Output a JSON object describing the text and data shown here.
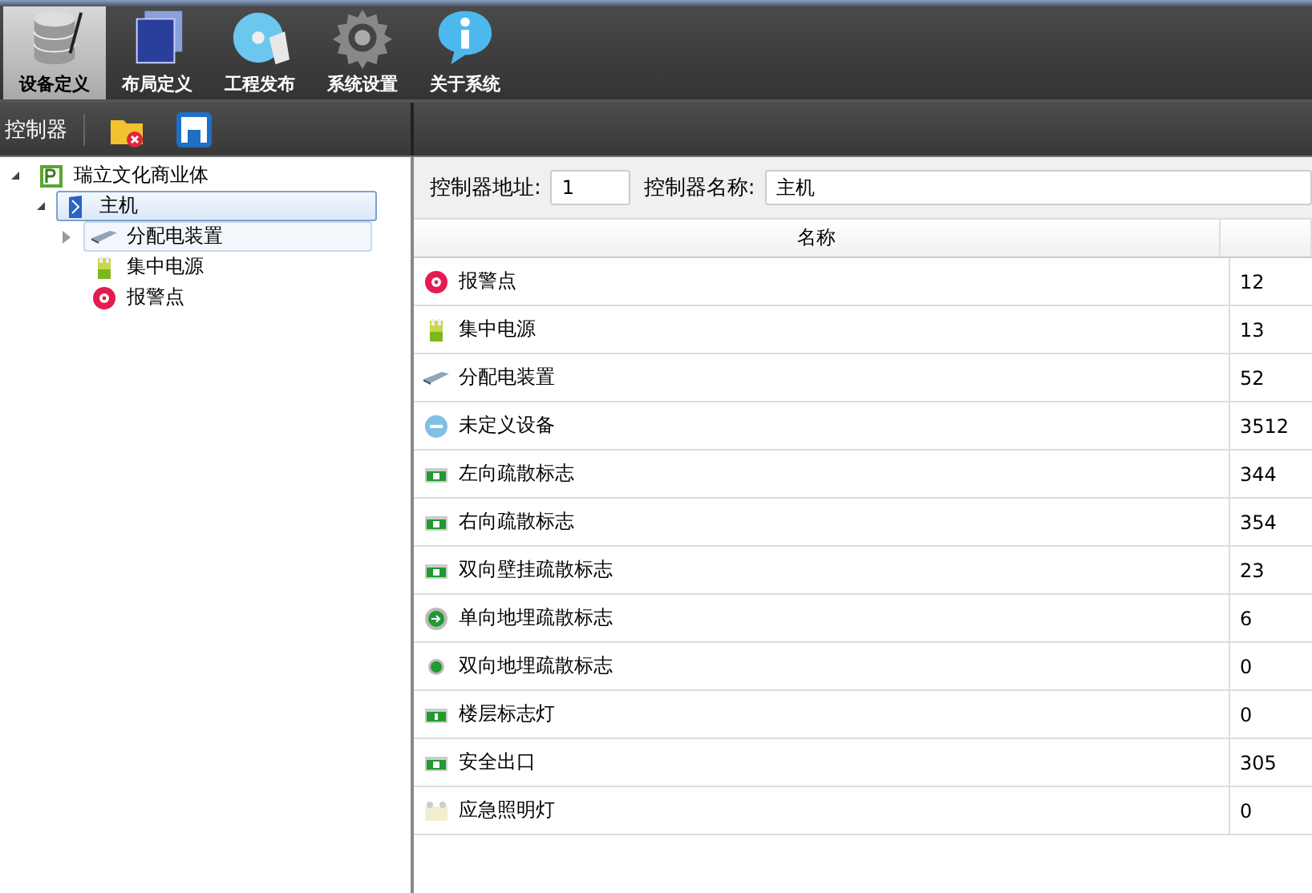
{
  "toolbar": {
    "buttons": [
      {
        "label": "设备定义",
        "kind": "database",
        "selected": true
      },
      {
        "label": "布局定义",
        "kind": "layers",
        "selected": false
      },
      {
        "label": "工程发布",
        "kind": "disc",
        "selected": false
      },
      {
        "label": "系统设置",
        "kind": "gear",
        "selected": false
      },
      {
        "label": "关于系统",
        "kind": "info",
        "selected": false
      }
    ]
  },
  "subbar": {
    "title": "控制器",
    "tools": [
      {
        "kind": "delete"
      },
      {
        "kind": "save"
      }
    ]
  },
  "tree": [
    {
      "label": "瑞立文化商业体",
      "kind": "site",
      "expanded": true,
      "selected": false,
      "children": [
        {
          "label": "主机",
          "kind": "controller",
          "expanded": true,
          "selected": true,
          "children": [
            {
              "label": "分配电装置",
              "kind": "distributor",
              "expanded": false,
              "selected": false,
              "hovered": true
            },
            {
              "label": "集中电源",
              "kind": "power",
              "selected": false,
              "hovered": false
            },
            {
              "label": "报警点",
              "kind": "alarm",
              "selected": false,
              "hovered": false
            }
          ]
        }
      ]
    }
  ],
  "form": {
    "address_label": "控制器地址:",
    "address": "1",
    "name_label": "控制器名称:",
    "name": "主机"
  },
  "table": {
    "columns": [
      "名称"
    ],
    "rows": [
      {
        "kind": "alarm",
        "name": "报警点",
        "count": "12"
      },
      {
        "kind": "power",
        "name": "集中电源",
        "count": "13"
      },
      {
        "kind": "distributor",
        "name": "分配电装置",
        "count": "52"
      },
      {
        "kind": "undefined",
        "name": "未定义设备",
        "count": "3512"
      },
      {
        "kind": "sign",
        "name": "左向疏散标志",
        "count": "344"
      },
      {
        "kind": "sign",
        "name": "右向疏散标志",
        "count": "354"
      },
      {
        "kind": "sign",
        "name": "双向壁挂疏散标志",
        "count": "23"
      },
      {
        "kind": "floor-arrow",
        "name": "单向地埋疏散标志",
        "count": "6"
      },
      {
        "kind": "floor-dot",
        "name": "双向地埋疏散标志",
        "count": "0"
      },
      {
        "kind": "floor-sign",
        "name": "楼层标志灯",
        "count": "0"
      },
      {
        "kind": "sign",
        "name": "安全出口",
        "count": "305"
      },
      {
        "kind": "lamp",
        "name": "应急照明灯",
        "count": "0"
      }
    ]
  }
}
